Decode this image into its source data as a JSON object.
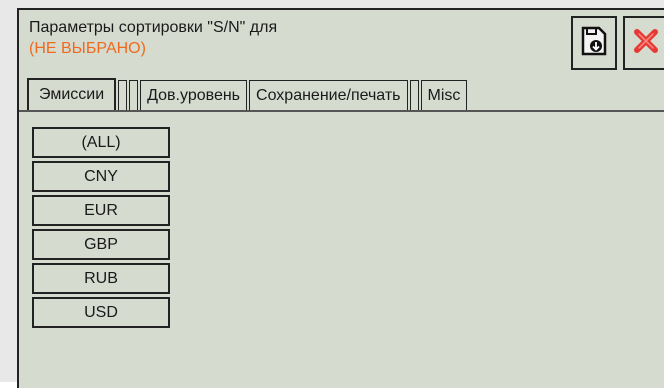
{
  "window": {
    "title": "Параметры сортировки \"S/N\" для",
    "subtitle": "(НЕ ВЫБРАНО)"
  },
  "toolbar": {
    "save_icon": "save-file-icon",
    "close_icon": "close-x-icon"
  },
  "tabs": [
    {
      "label": "Эмиссии",
      "active": true
    },
    {
      "label": "",
      "active": false
    },
    {
      "label": "",
      "active": false
    },
    {
      "label": "Дов.уровень",
      "active": false
    },
    {
      "label": "Сохранение/печать",
      "active": false
    },
    {
      "label": "",
      "active": false
    },
    {
      "label": "Misc",
      "active": false
    }
  ],
  "emissions": {
    "items": [
      "(ALL)",
      "CNY",
      "EUR",
      "GBP",
      "RUB",
      "USD"
    ]
  },
  "colors": {
    "background": "#d6dbcf",
    "subtitle": "#ef6a1f",
    "close": "#e53935"
  }
}
